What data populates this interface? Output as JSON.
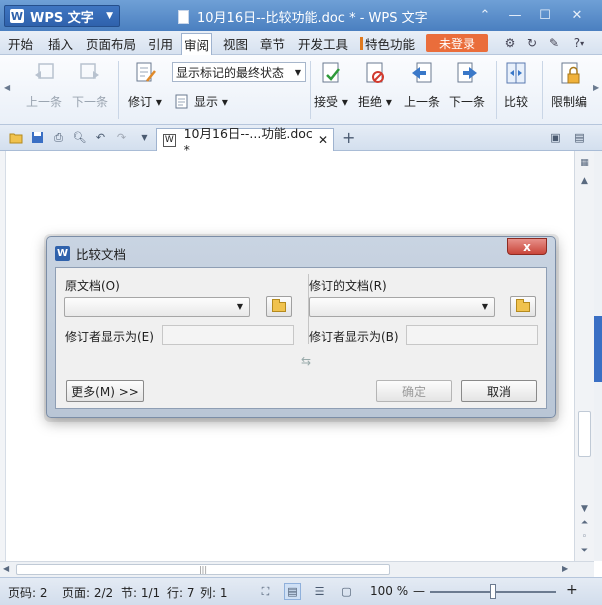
{
  "titlebar": {
    "app_name": "WPS 文字",
    "logo_letter": "W",
    "document_title": "10月16日--比较功能.doc * - WPS 文字"
  },
  "menu": {
    "items": [
      "开始",
      "插入",
      "页面布局",
      "引用",
      "审阅",
      "视图",
      "章节",
      "开发工具",
      "特色功能"
    ],
    "active": "审阅",
    "login_label": "未登录",
    "help_label": "?"
  },
  "ribbon": {
    "prev_disabled_label": "上一条",
    "next_disabled_label": "下一条",
    "revise_label": "修订",
    "show_markup_value": "显示标记的最终状态",
    "show_label": "显示",
    "accept_label": "接受",
    "reject_label": "拒绝",
    "prev_label": "上一条",
    "next_label": "下一条",
    "compare_label": "比较",
    "restrict_label": "限制编"
  },
  "tabbar": {
    "doc_tab_label": "10月16日--...功能.doc *",
    "close_glyph": "✕",
    "new_tab_glyph": "+"
  },
  "dialog": {
    "title": "比较文档",
    "close_glyph": "x",
    "original_label": "原文档(O)",
    "revised_label": "修订的文档(R)",
    "original_reviewer_label": "修订者显示为(E)",
    "revised_reviewer_label": "修订者显示为(B)",
    "more_button": "更多(M) >>",
    "ok_button": "确定",
    "cancel_button": "取消",
    "swap_glyph": "⇆"
  },
  "statusbar": {
    "page_code": "页码: 2",
    "page": "页面: 2/2",
    "section": "节: 1/1",
    "row": "行: 7",
    "col": "列: 1",
    "zoom": "100 %",
    "zoom_minus": "—",
    "zoom_plus": "+",
    "zoom_fraction": 0.5
  },
  "colors": {
    "titlebar": "#4a7fc0",
    "login_button": "#ea6d3b",
    "dialog_close": "#c9463a"
  }
}
